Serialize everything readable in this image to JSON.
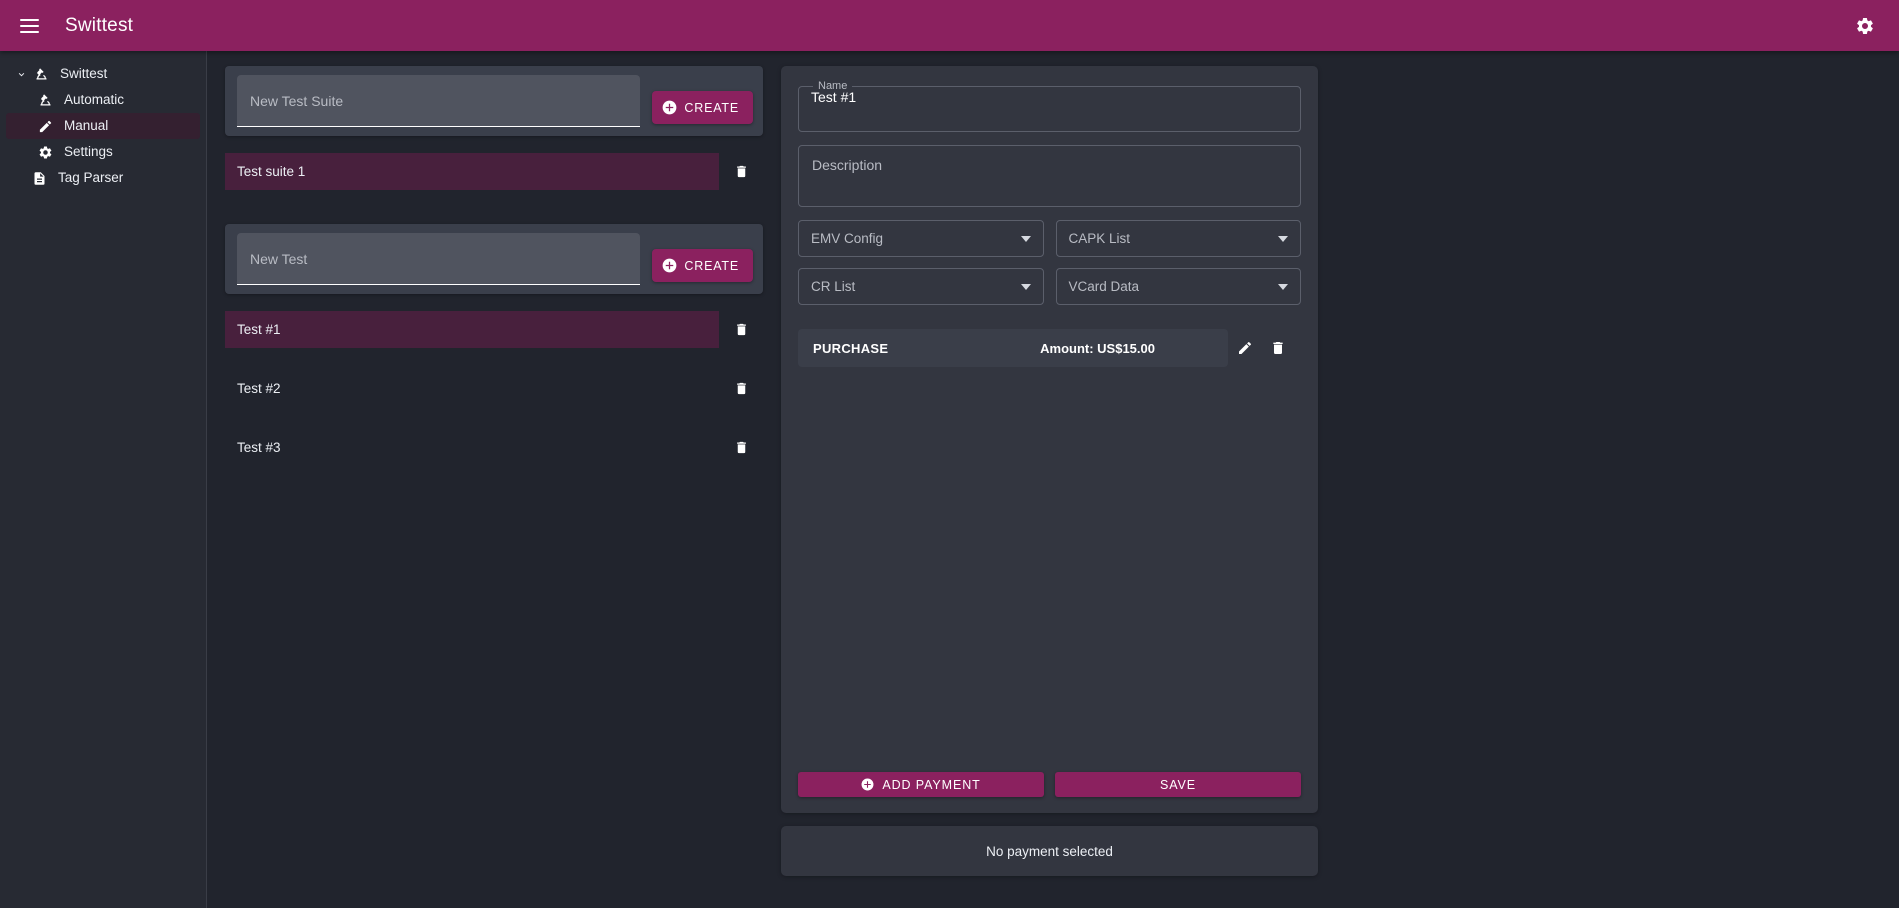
{
  "app": {
    "title": "Swittest",
    "accent": "#8b215f",
    "selected_bg": "#48203d",
    "panel_bg": "#333640",
    "page_bg": "#21242d",
    "sidebar_bg": "#272a33"
  },
  "topbar": {
    "menu_icon": "hamburger-menu-icon",
    "title": "Swittest",
    "settings_icon": "gear-icon"
  },
  "sidebar": {
    "items": [
      {
        "label": "Swittest",
        "icon": "microscope-icon",
        "level": 0,
        "expanded": true,
        "active": false
      },
      {
        "label": "Automatic",
        "icon": "microscope-icon",
        "level": 1,
        "expanded": null,
        "active": false
      },
      {
        "label": "Manual",
        "icon": "pencil-icon",
        "level": 1,
        "expanded": null,
        "active": true
      },
      {
        "label": "Settings",
        "icon": "gear-icon",
        "level": 1,
        "expanded": null,
        "active": false
      },
      {
        "label": "Tag Parser",
        "icon": "document-icon",
        "level": 0,
        "expanded": null,
        "active": false
      }
    ]
  },
  "suites_panel": {
    "new_suite_placeholder": "New Test Suite",
    "new_suite_value": "",
    "create_suite_label": "CREATE",
    "create_icon": "plus-circle-icon",
    "suites": [
      {
        "name": "Test suite 1",
        "selected": true,
        "delete_icon": "trash-icon"
      }
    ]
  },
  "tests_panel": {
    "new_test_placeholder": "New Test",
    "new_test_value": "",
    "create_test_label": "CREATE",
    "create_icon": "plus-circle-icon",
    "tests": [
      {
        "name": "Test #1",
        "selected": true,
        "delete_icon": "trash-icon"
      },
      {
        "name": "Test #2",
        "selected": false,
        "delete_icon": "trash-icon"
      },
      {
        "name": "Test #3",
        "selected": false,
        "delete_icon": "trash-icon"
      }
    ]
  },
  "detail": {
    "name_legend": "Name",
    "name_value": "Test #1",
    "description_placeholder": "Description",
    "description_value": "",
    "selects": [
      {
        "label": "EMV Config",
        "value": "",
        "caret_icon": "chevron-down-icon"
      },
      {
        "label": "CAPK List",
        "value": "",
        "caret_icon": "chevron-down-icon"
      },
      {
        "label": "CR List",
        "value": "",
        "caret_icon": "chevron-down-icon"
      },
      {
        "label": "VCard Data",
        "value": "",
        "caret_icon": "chevron-down-icon"
      }
    ],
    "payments": [
      {
        "type": "PURCHASE",
        "amount": "Amount: US$15.00",
        "edit_icon": "pencil-icon",
        "delete_icon": "trash-icon"
      }
    ],
    "add_payment_label": "ADD PAYMENT",
    "add_payment_icon": "plus-circle-icon",
    "save_label": "SAVE"
  },
  "status_bar": {
    "message": "No payment selected"
  }
}
